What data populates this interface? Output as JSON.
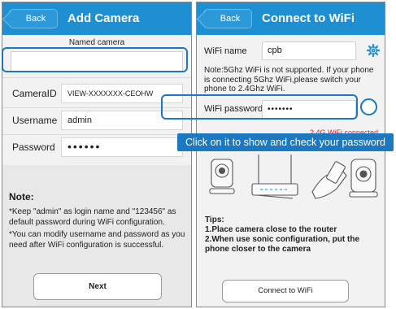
{
  "left_screen": {
    "back_label": "Back",
    "title": "Add Camera",
    "named_camera_label": "Named camera",
    "named_camera_value": "",
    "fields": [
      {
        "label": "CameraID",
        "value": "VIEW-XXXXXXX-CEOHW"
      },
      {
        "label": "Username",
        "value": "admin"
      },
      {
        "label": "Password",
        "value": "••••••"
      }
    ],
    "note_title": "Note:",
    "notes": [
      "*Keep \"admin\" as login name and \"123456\" as default password during WiFi configuration.",
      "*You can modify username and password as you need after WiFi configuration is successful."
    ],
    "next_label": "Next"
  },
  "right_screen": {
    "back_label": "Back",
    "title": "Connect to WiFi",
    "wifi_name_label": "WiFi name",
    "wifi_name_value": "cpb",
    "note": "Note:5Ghz WiFi is not supported. If your phone is connecting 5Ghz WiFi,please switch your phone to 2.4Ghz WiFi.",
    "wifi_password_label": "WiFi password",
    "wifi_password_value": "•••••••",
    "status": "2.4G WiFi connected",
    "tips_title": "Tips:",
    "tips": [
      "1.Place camera close to the router",
      "2.When use sonic configuration, put the phone closer to the camera"
    ],
    "connect_label": "Connect to WiFi"
  },
  "annotation": {
    "tooltip": "Click on it to show and check your password"
  },
  "colors": {
    "navbar": "#1f8fd3",
    "highlight": "#1c78c0",
    "status_red": "#e02020"
  },
  "icons": [
    "back-chevron-icon",
    "gear-icon",
    "eye-toggle-icon"
  ]
}
